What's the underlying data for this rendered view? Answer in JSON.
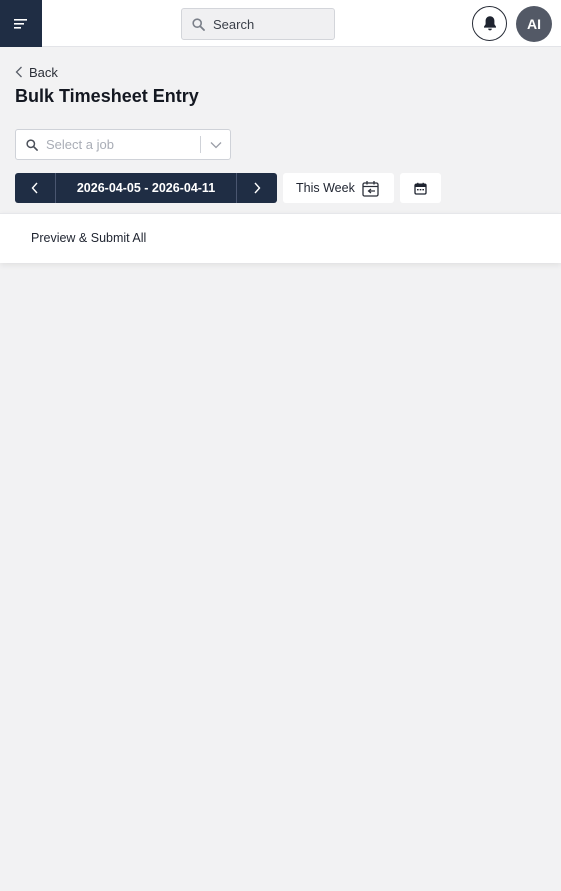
{
  "topbar": {
    "search_placeholder": "Search",
    "avatar_initials": "AI"
  },
  "page": {
    "back_label": "Back",
    "title": "Bulk Timesheet Entry"
  },
  "job_select": {
    "placeholder": "Select a job"
  },
  "date_range": {
    "label": "2026-04-05 - 2026-04-11"
  },
  "this_week_label": "This Week",
  "actions": {
    "preview_submit_label": "Preview & Submit All"
  },
  "colors": {
    "navy": "#1f2d44",
    "background": "#f2f2f3"
  },
  "icons": {
    "menu": "menu-icon",
    "search": "search-icon",
    "bell": "bell-icon",
    "back": "chevron-left-icon",
    "dropdown": "chevron-down-icon",
    "prev": "chevron-left-icon",
    "next": "chevron-right-icon",
    "this_week": "calendar-arrow-icon",
    "calendar": "calendar-icon"
  }
}
